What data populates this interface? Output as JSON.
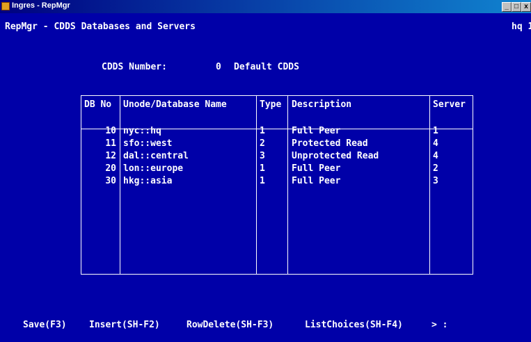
{
  "window": {
    "title": "Ingres - RepMgr",
    "buttons": [
      "_",
      "□",
      "x"
    ]
  },
  "screen": {
    "header_left": "RepMgr - CDDS Databases and Servers",
    "header_right": "hq 1",
    "cdds_label": "CDDS Number:",
    "cdds_number": "0",
    "cdds_name": "Default CDDS"
  },
  "table": {
    "columns": [
      "DB No",
      "Unode/Database Name",
      "Type",
      "Description",
      "Server"
    ],
    "rows": [
      {
        "db_no": "10",
        "name": "nyc::hq",
        "type": "1",
        "description": "Full Peer",
        "server": "1"
      },
      {
        "db_no": "11",
        "name": "sfo::west",
        "type": "2",
        "description": "Protected Read",
        "server": "4"
      },
      {
        "db_no": "12",
        "name": "dal::central",
        "type": "3",
        "description": "Unprotected Read",
        "server": "4"
      },
      {
        "db_no": "20",
        "name": "lon::europe",
        "type": "1",
        "description": "Full Peer",
        "server": "2"
      },
      {
        "db_no": "30",
        "name": "hkg::asia",
        "type": "1",
        "description": "Full Peer",
        "server": "3"
      }
    ]
  },
  "menu": {
    "save": "Save(F3)",
    "insert": "Insert(SH-F2)",
    "row_delete": "RowDelete(SH-F3)",
    "list_choices": "ListChoices(SH-F4)",
    "prompt": "> :"
  }
}
